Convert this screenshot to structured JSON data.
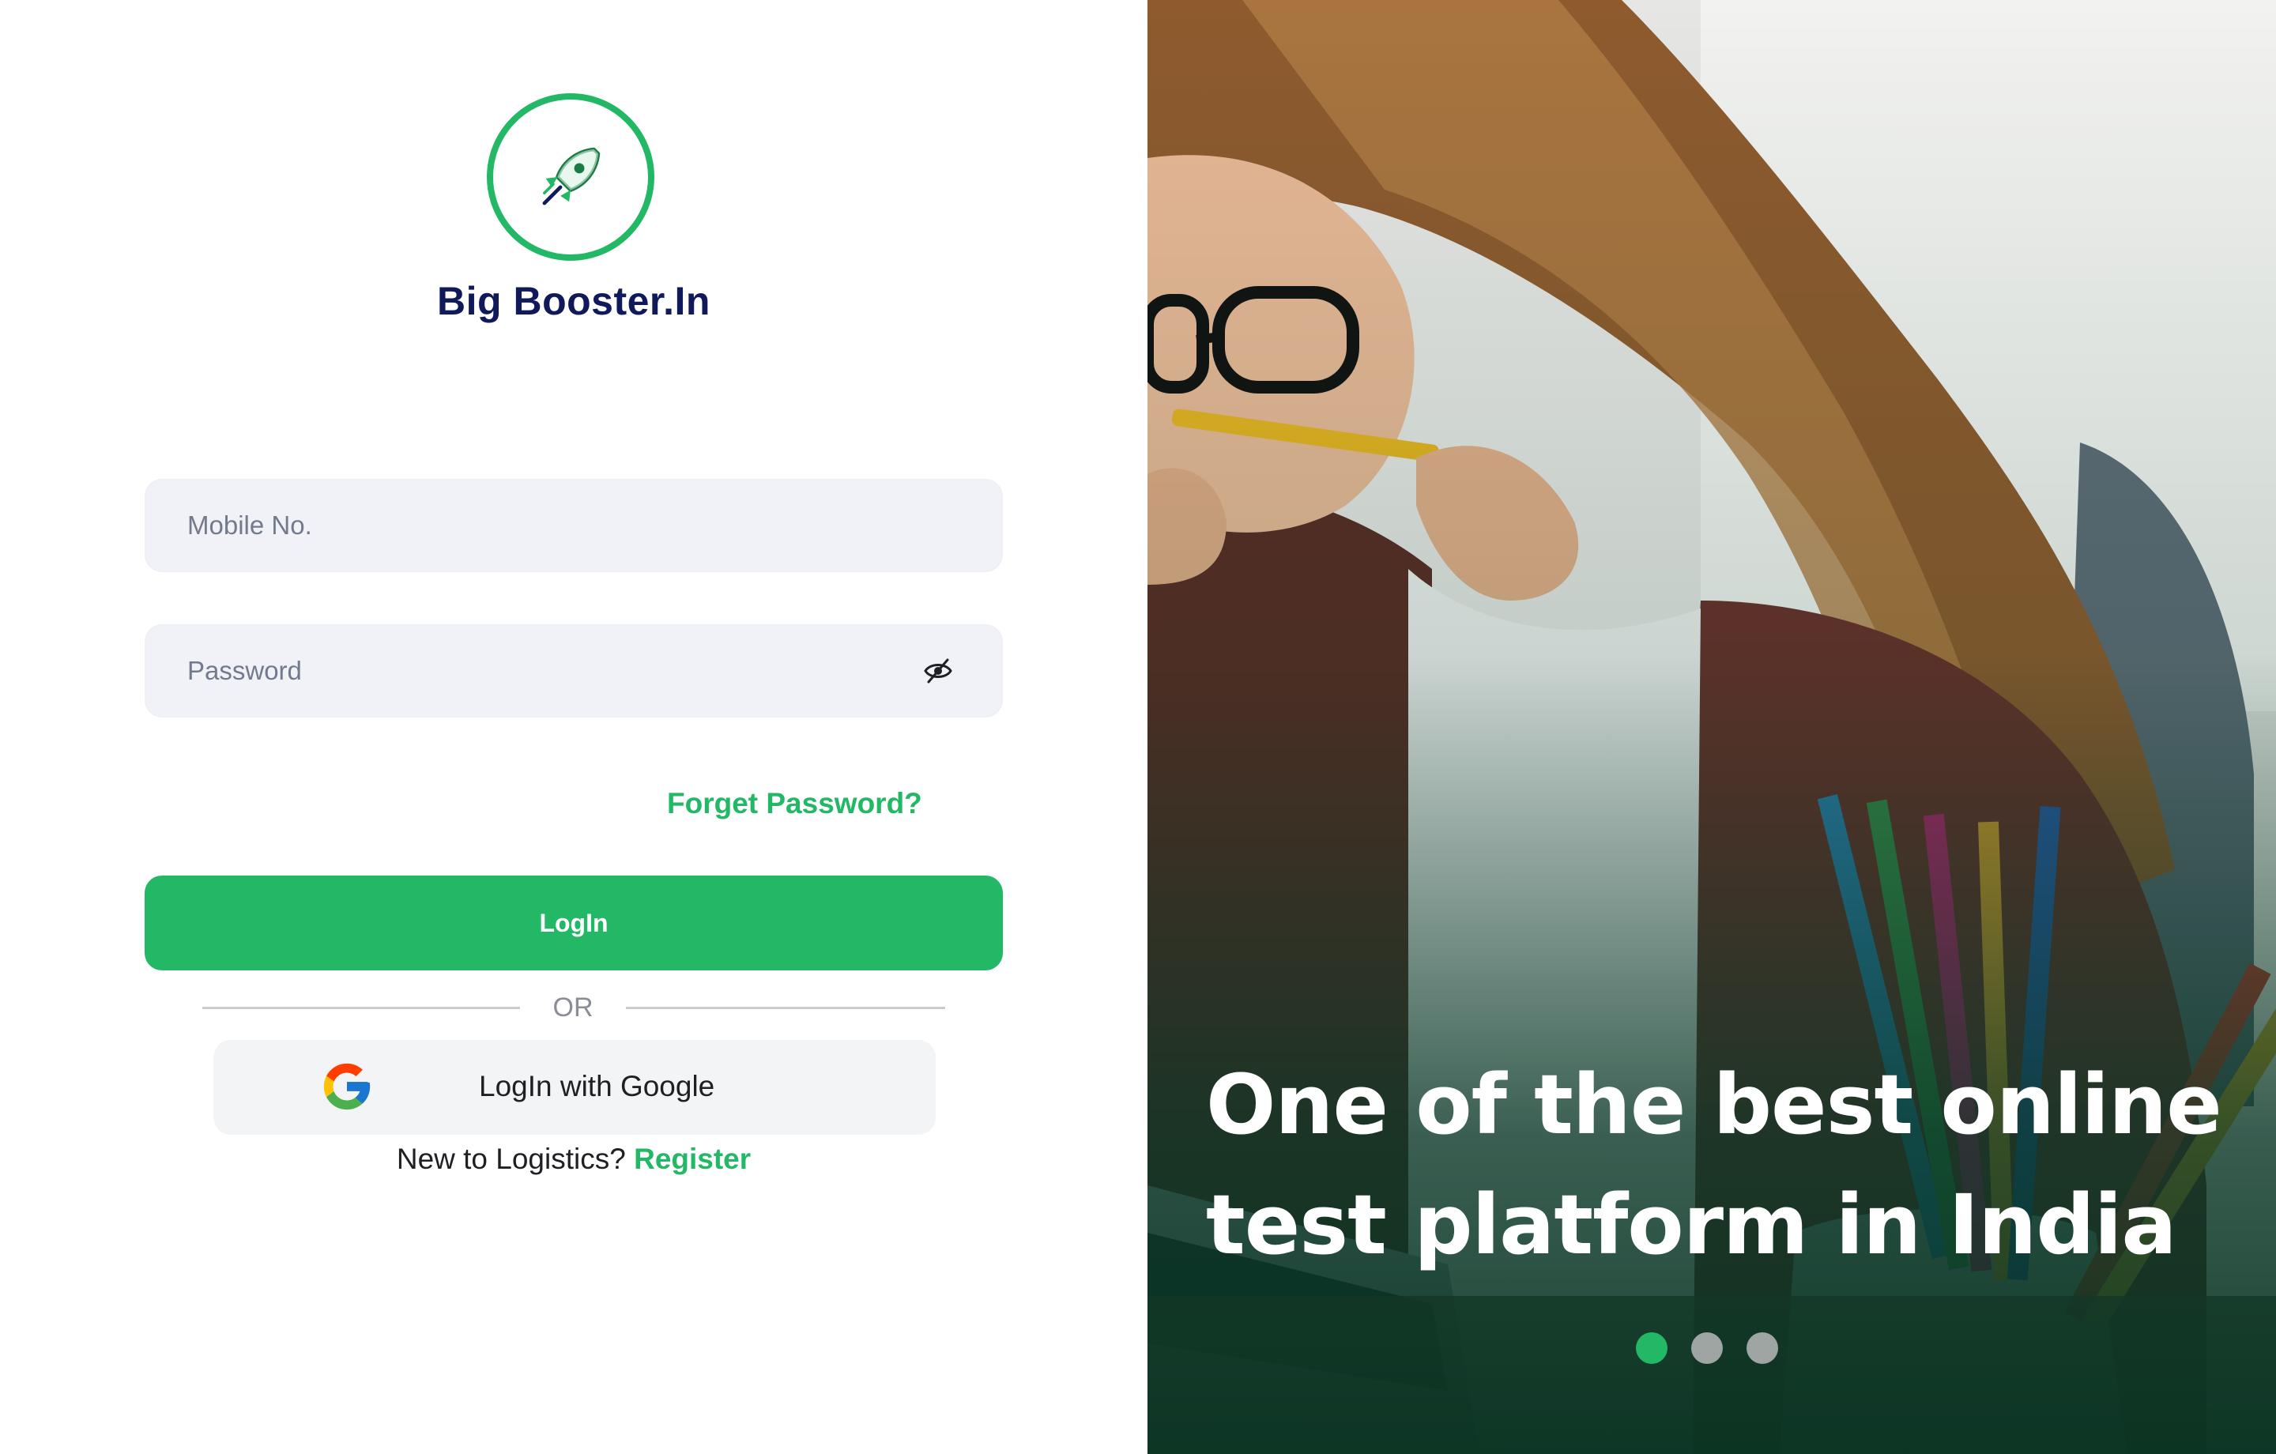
{
  "brand": {
    "name": "Big Booster.In",
    "logo_icon": "rocket-icon",
    "accent_color": "#22b865",
    "title_color": "#101a5b"
  },
  "form": {
    "mobile_placeholder": "Mobile No.",
    "password_placeholder": "Password",
    "password_toggle_icon": "eye-off-icon",
    "forgot_password": "Forget Password?",
    "login_button": "LogIn",
    "divider_text": "OR",
    "google_button": "LogIn with Google",
    "google_icon": "google-icon",
    "register_prompt": "New to Logistics?",
    "register_link": "Register"
  },
  "hero": {
    "headline_line1": "One of the best online",
    "headline_line2": "test platform in India",
    "carousel": {
      "count": 3,
      "active_index": 0
    }
  }
}
